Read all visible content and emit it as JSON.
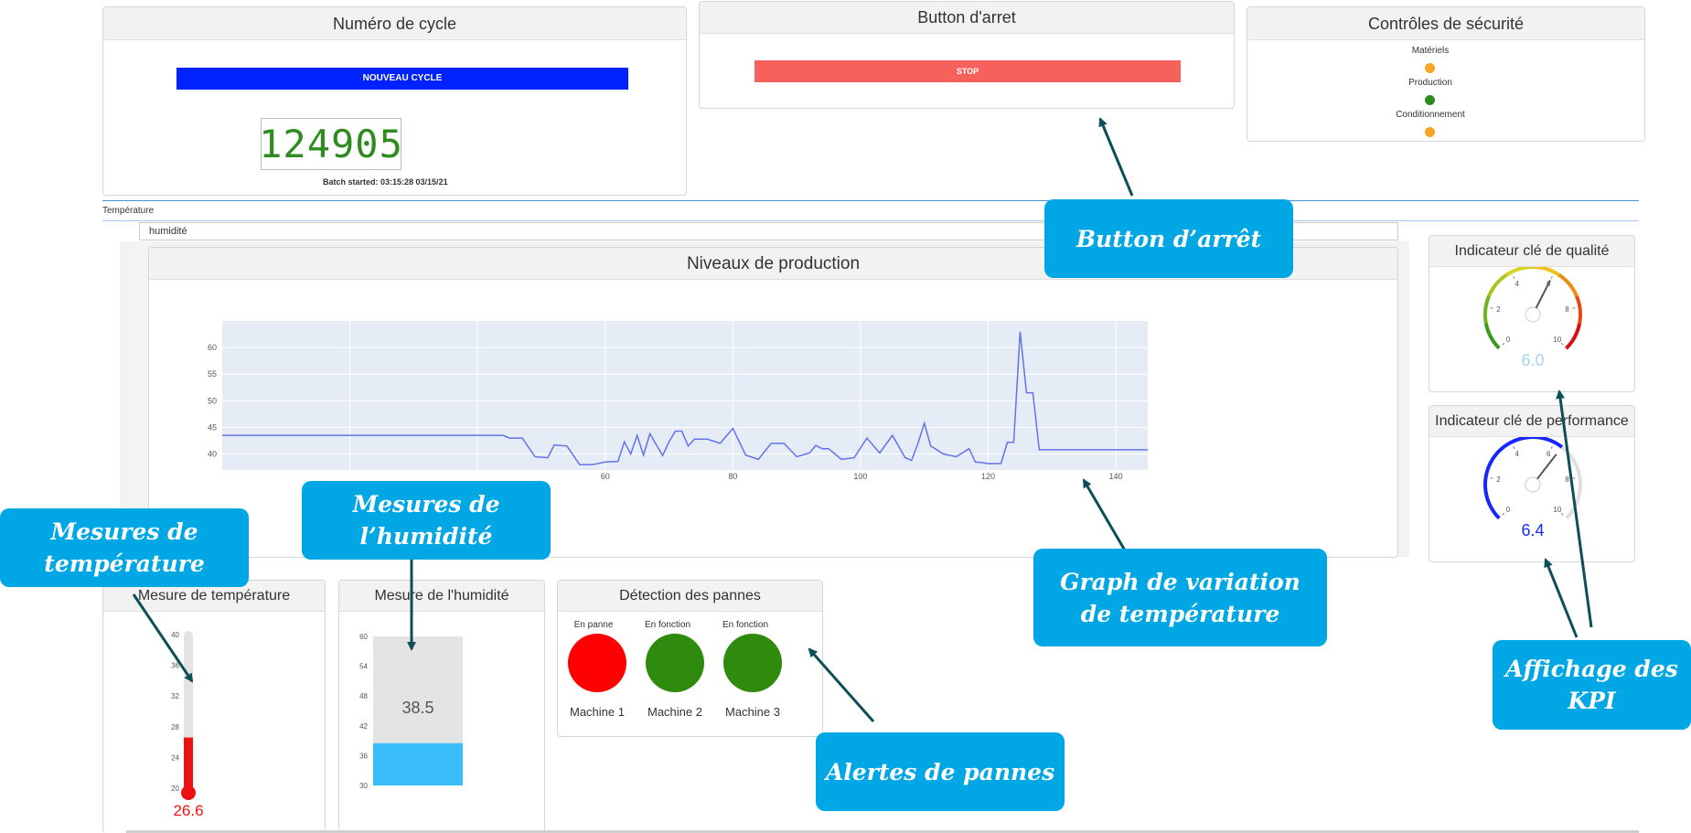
{
  "cycle_panel": {
    "title": "Numéro de cycle",
    "new_cycle_label": "NOUVEAU CYCLE",
    "counter": "124905",
    "batch_started": "Batch started: 03:15:28 03/15/21"
  },
  "stop_panel": {
    "title": "Button d'arret",
    "stop_label": "STOP"
  },
  "safety_panel": {
    "title": "Contrôles de sécurité",
    "items": [
      {
        "label": "Matériels",
        "color": "#f5a623"
      },
      {
        "label": "Production",
        "color": "#2e8b1e"
      },
      {
        "label": "Conditionnement",
        "color": "#f5a623"
      }
    ]
  },
  "tabs": {
    "temperature": "Température",
    "humidity": "humidité"
  },
  "production_panel": {
    "title": "Niveaux de production"
  },
  "chart_data": {
    "type": "line",
    "title": "Niveaux de production",
    "xlabel": "",
    "ylabel": "",
    "xlim": [
      0,
      145
    ],
    "ylim": [
      37,
      65
    ],
    "x_ticks": [
      60,
      80,
      100,
      120,
      140
    ],
    "y_ticks": [
      40,
      45,
      50,
      55,
      60
    ],
    "grid": true,
    "line_color": "#6272ea",
    "series": [
      {
        "x": [
          0,
          44,
          45,
          47,
          49,
          51,
          52,
          54,
          56,
          58,
          60,
          62,
          63,
          64,
          65,
          66,
          67,
          69,
          70,
          71,
          72,
          73,
          74,
          76,
          78,
          80,
          82,
          84,
          86,
          88,
          90,
          92,
          93,
          94,
          95,
          97,
          99,
          101,
          103,
          105,
          107,
          108,
          109,
          110,
          111,
          113,
          115,
          117,
          118,
          119,
          120,
          122,
          123,
          124,
          125,
          126,
          127,
          128,
          129,
          145
        ],
        "y": [
          43.5,
          43.5,
          43,
          43,
          39.5,
          39.3,
          41.7,
          41.5,
          38,
          38,
          38.5,
          38.6,
          42.3,
          40,
          43.5,
          39.8,
          43.8,
          39.7,
          42.3,
          44.3,
          44.3,
          41.5,
          42.8,
          42.8,
          42,
          44.8,
          39.8,
          39,
          42,
          42,
          39.5,
          40.2,
          41.6,
          41,
          41,
          39,
          39.3,
          43,
          40.2,
          43.5,
          39.3,
          38.8,
          42,
          45.8,
          41.5,
          40,
          39.5,
          41,
          38.5,
          38.4,
          38.2,
          38.2,
          42.2,
          42.2,
          63,
          51.5,
          51.5,
          40.8,
          40.8,
          40.8
        ]
      }
    ]
  },
  "quality_kpi": {
    "title": "Indicateur clé de qualité",
    "value": "6.0",
    "value_num": 6.0,
    "min": 0,
    "max": 10,
    "tick_labels": [
      "0",
      "2",
      "4",
      "6",
      "8",
      "10"
    ]
  },
  "performance_kpi": {
    "title": "Indicateur clé de performance",
    "value": "6.4",
    "value_num": 6.4,
    "min": 0,
    "max": 10,
    "tick_labels": [
      "0",
      "2",
      "4",
      "6",
      "8",
      "10"
    ]
  },
  "temperature_panel": {
    "title": "Mesure de température",
    "value": "26.6",
    "value_num": 26.6,
    "scale_min": 20,
    "scale_max": 40,
    "tick_labels": [
      "40",
      "36",
      "32",
      "28",
      "24",
      "20"
    ]
  },
  "humidity_panel": {
    "title": "Mesure de l'humidité",
    "value": "38.5",
    "value_num": 38.5,
    "scale_min": 30,
    "scale_max": 60,
    "tick_labels": [
      "60",
      "54",
      "48",
      "42",
      "36",
      "30"
    ]
  },
  "faults_panel": {
    "title": "Détection des pannes",
    "machines": [
      {
        "status": "En panne",
        "name": "Machine 1",
        "color": "#ff0000"
      },
      {
        "status": "En fonction",
        "name": "Machine 2",
        "color": "#2e8b0e"
      },
      {
        "status": "En fonction",
        "name": "Machine 3",
        "color": "#2e8b0e"
      }
    ]
  },
  "callouts": {
    "stop": "Button d’arrêt",
    "humidity": "Mesures de l’humidité",
    "temperature": "Mesures de température",
    "graph": "Graph de variation de température",
    "faults": "Alertes de pannes",
    "kpi": "Affichage des KPI"
  }
}
